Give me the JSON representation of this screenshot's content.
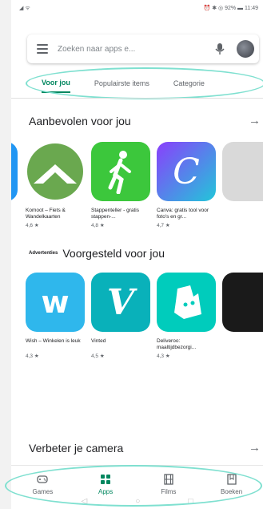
{
  "status_bar": {
    "left": "◢ ᯤ",
    "right": "⏰ ✱ ◎ 92% ▬ 11:49"
  },
  "search": {
    "placeholder": "Zoeken naar apps e..."
  },
  "tabs": [
    {
      "label": "Voor jou",
      "active": true
    },
    {
      "label": "Populairste items",
      "active": false
    },
    {
      "label": "Categorie",
      "active": false
    }
  ],
  "sections": {
    "recommended": {
      "title": "Aanbevolen voor jou",
      "apps": [
        {
          "name": "Komoot – Fiets & Wandelkaarten",
          "rating": "4,6 ★",
          "icon": "komoot-icon"
        },
        {
          "name": "Stappenteller - gratis stappen-...",
          "rating": "4,8 ★",
          "icon": "pedometer-icon"
        },
        {
          "name": "Canva: gratis tool voor foto's en gr...",
          "rating": "4,7 ★",
          "icon": "canva-icon"
        }
      ]
    },
    "suggested": {
      "ads_label": "Advertenties",
      "title": "Voorgesteld voor jou",
      "apps": [
        {
          "name": "Wish – Winkelen is leuk",
          "rating": "4,3 ★",
          "icon": "wish-icon"
        },
        {
          "name": "Vinted",
          "rating": "4,5 ★",
          "icon": "vinted-icon"
        },
        {
          "name": "Deliveroo: maaltijdbezorgi...",
          "rating": "4,3 ★",
          "icon": "deliveroo-icon"
        }
      ]
    },
    "camera": {
      "title": "Verbeter je camera"
    }
  },
  "bottom_nav": [
    {
      "label": "Games",
      "active": false
    },
    {
      "label": "Apps",
      "active": true
    },
    {
      "label": "Films",
      "active": false
    },
    {
      "label": "Boeken",
      "active": false
    }
  ],
  "colors": {
    "accent": "#01875f",
    "highlight_oval": "#7fe0d0"
  }
}
